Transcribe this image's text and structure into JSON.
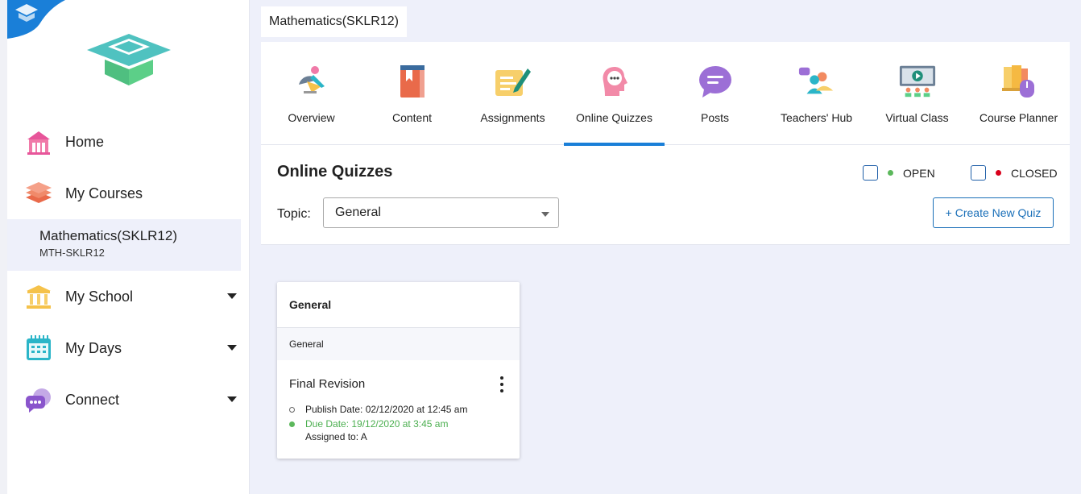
{
  "sidebar": {
    "nav": [
      {
        "label": "Home",
        "icon": "home-icon"
      },
      {
        "label": "My Courses",
        "icon": "books-icon"
      },
      {
        "label": "My School",
        "icon": "school-icon"
      },
      {
        "label": "My Days",
        "icon": "calendar-icon"
      },
      {
        "label": "Connect",
        "icon": "chat-icon"
      }
    ],
    "selected_course": {
      "title": "Mathematics(SKLR12)",
      "code": "MTH-SKLR12"
    }
  },
  "breadcrumb": "Mathematics(SKLR12)",
  "tabs": [
    {
      "label": "Overview",
      "icon": "overview-icon"
    },
    {
      "label": "Content",
      "icon": "book-icon"
    },
    {
      "label": "Assignments",
      "icon": "assignment-icon"
    },
    {
      "label": "Online Quizzes",
      "icon": "quiz-icon",
      "active": true
    },
    {
      "label": "Posts",
      "icon": "posts-icon"
    },
    {
      "label": "Teachers' Hub",
      "icon": "teachers-icon"
    },
    {
      "label": "Virtual Class",
      "icon": "virtual-class-icon"
    },
    {
      "label": "Course Planner",
      "icon": "planner-icon"
    }
  ],
  "quizzes": {
    "title": "Online Quizzes",
    "legend_open": "OPEN",
    "legend_closed": "CLOSED",
    "topic_label": "Topic:",
    "topic_value": "General",
    "create_label": "+ Create New Quiz"
  },
  "card": {
    "header": "General",
    "topic": "General",
    "name": "Final Revision",
    "publish": "Publish Date: 02/12/2020 at 12:45 am",
    "due": "Due Date: 19/12/2020 at 3:45 am",
    "assigned": "Assigned to: A"
  },
  "colors": {
    "accent": "#1a7fd8",
    "open": "#5cb85c",
    "closed": "#d9001b",
    "due_text": "#4caf50"
  }
}
